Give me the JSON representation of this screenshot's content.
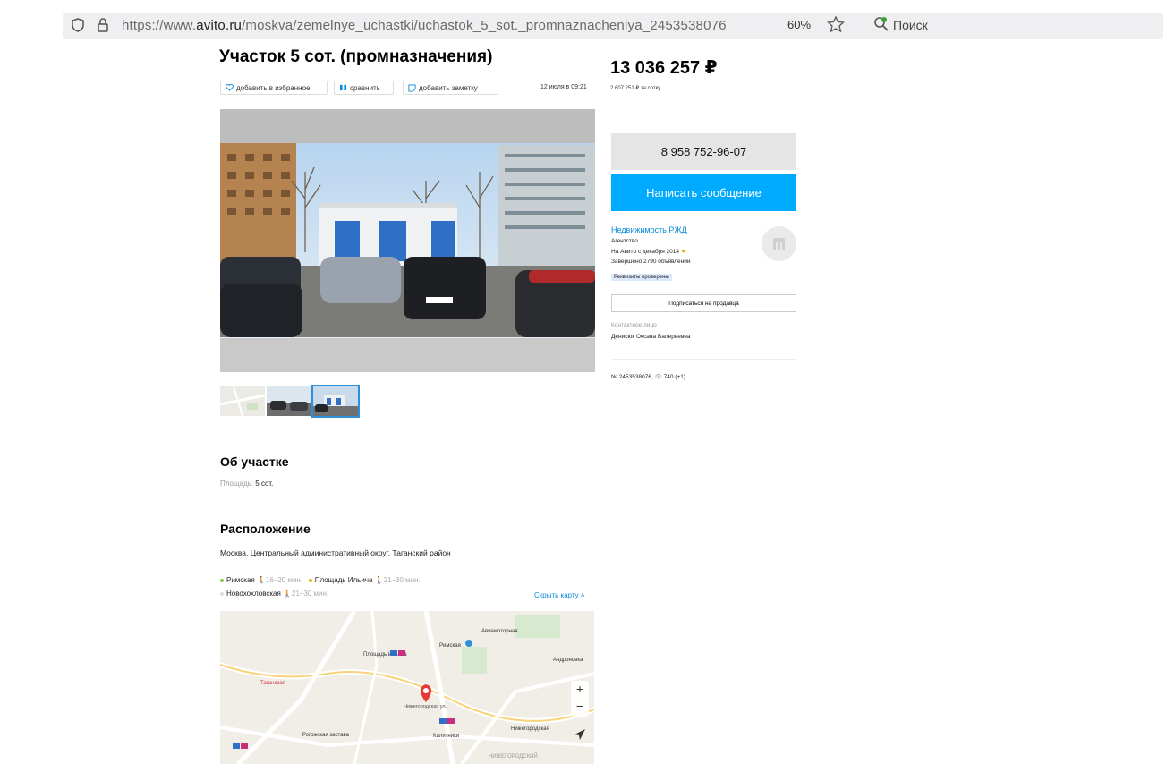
{
  "browser": {
    "url_prefix": "https://www.",
    "url_domain": "avito.ru",
    "url_path": "/moskva/zemelnye_uchastki/uchastok_5_sot._promnaznacheniya_2453538076",
    "zoom": "60%",
    "search_label": "Поиск"
  },
  "listing": {
    "title": "Участок 5 сот. (промназначения)",
    "add_favorite": "добавить в избранное",
    "compare": "сравнить",
    "add_note": "добавить заметку",
    "date": "12 июля в 09:21"
  },
  "price": {
    "value": "13 036 257",
    "currency": "₽",
    "per_unit": "2 607 251 ₽ за сотку"
  },
  "contact": {
    "phone": "8 958 752-96-07",
    "message_button": "Написать сообщение",
    "seller_name": "Недвижимость РЖД",
    "seller_type": "Агентство",
    "on_avito": "На Авито с декабря 2014",
    "completed": "Завершено 2790 объявлений",
    "verified": "Реквизиты проверены",
    "subscribe": "Подписаться на продавца",
    "contact_person_label": "Контактное лицо",
    "contact_person": "Денисюк Оксана Валерьевна",
    "ad_number": "№ 2453538076,",
    "views": "740 (+1)"
  },
  "about": {
    "heading": "Об участке",
    "area_label": "Площадь:",
    "area_value": "5 сот."
  },
  "location": {
    "heading": "Расположение",
    "address": "Москва, Центральный административный округ, Таганский район",
    "metro": [
      {
        "name": "Римская",
        "time": "16–20 мин.",
        "color": "#8bc34a"
      },
      {
        "name": "Площадь Ильича",
        "time": "21–30 мин.",
        "color": "#f4b400"
      },
      {
        "name": "Новохохловская",
        "time": "21–30 мин.",
        "color": "#dcdcdc"
      }
    ],
    "hide_map": "Скрыть карту"
  },
  "map_labels": {
    "taganskaya": "Таганская",
    "ploshchad": "Площадь Ильича",
    "rimskaya": "Римская",
    "aviamotornaya": "Авиамоторная",
    "nizhegorodskaya": "Нижегородская",
    "kalitniki": "Калитники",
    "nizhegorodsky": "НИЖЕГОРОДСКИЙ",
    "andronovka": "Андроновка",
    "rogozhskaya": "Рогожская застава",
    "nizhegorodskaya_st": "Нижегородская ул.",
    "zoom_in": "+",
    "zoom_out": "−"
  },
  "colors": {
    "accent": "#00aaff",
    "link": "#0a8ad8",
    "phone_bg": "#e5e5e5"
  }
}
